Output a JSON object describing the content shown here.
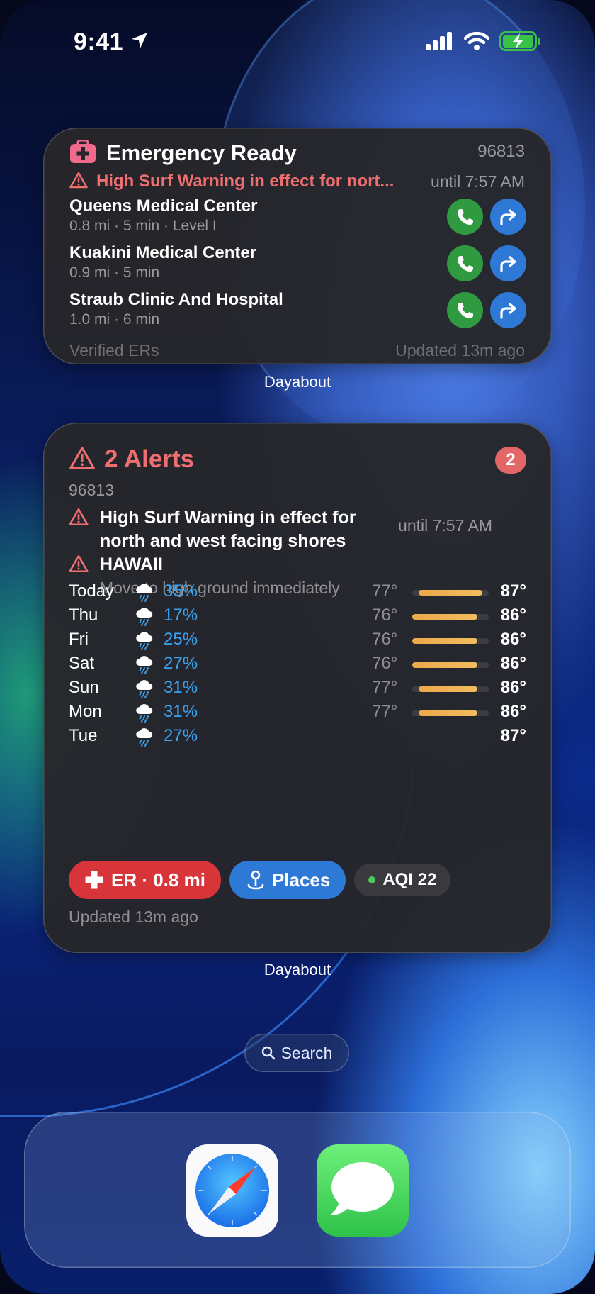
{
  "status_bar": {
    "time": "9:41"
  },
  "emergency_widget": {
    "title": "Emergency Ready",
    "zip": "96813",
    "alert": {
      "text": "High Surf Warning in effect for nort...",
      "until": "until 7:57 AM"
    },
    "hospitals": [
      {
        "name": "Queens Medical Center",
        "meta": "0.8 mi · 5 min · Level I"
      },
      {
        "name": "Kuakini Medical Center",
        "meta": "0.9 mi · 5 min"
      },
      {
        "name": "Straub Clinic And  Hospital",
        "meta": "1.0 mi · 6 min"
      }
    ],
    "footer_left": "Verified ERs",
    "footer_right": "Updated 13m ago",
    "caption": "Dayabout"
  },
  "weather_widget": {
    "title": "2 Alerts",
    "badge": "2",
    "zip": "96813",
    "alerts": [
      {
        "title_line1": "High Surf Warning in effect for",
        "title_line2": "north and west facing shores",
        "until": "until 7:57 AM"
      },
      {
        "title": "HAWAII",
        "subtitle": "Move to high ground immediately"
      }
    ],
    "forecast": [
      {
        "day": "Today",
        "precip": "35%",
        "low": "77°",
        "high": "87°",
        "bar_from": 0.08,
        "bar_to": 0.92
      },
      {
        "day": "Thu",
        "precip": "17%",
        "low": "76°",
        "high": "86°",
        "bar_from": 0.0,
        "bar_to": 0.85
      },
      {
        "day": "Fri",
        "precip": "25%",
        "low": "76°",
        "high": "86°",
        "bar_from": 0.0,
        "bar_to": 0.85
      },
      {
        "day": "Sat",
        "precip": "27%",
        "low": "76°",
        "high": "86°",
        "bar_from": 0.0,
        "bar_to": 0.85
      },
      {
        "day": "Sun",
        "precip": "31%",
        "low": "77°",
        "high": "86°",
        "bar_from": 0.08,
        "bar_to": 0.85
      },
      {
        "day": "Mon",
        "precip": "31%",
        "low": "77°",
        "high": "86°",
        "bar_from": 0.08,
        "bar_to": 0.85
      },
      {
        "day": "Tue",
        "precip": "27%",
        "low": "",
        "high": "87°"
      }
    ],
    "chips": {
      "er": "ER · 0.8 mi",
      "places": "Places",
      "aqi": "AQI 22"
    },
    "updated": "Updated 13m ago",
    "caption": "Dayabout"
  },
  "search": {
    "label": "Search"
  },
  "dock": {
    "apps": [
      "Safari",
      "Messages"
    ]
  },
  "colors": {
    "alert_red": "#ef6e70",
    "call_green": "#2f9a3f",
    "directions_blue": "#2f79d6",
    "precip_blue": "#39a3f2",
    "er_red": "#d8353a"
  }
}
